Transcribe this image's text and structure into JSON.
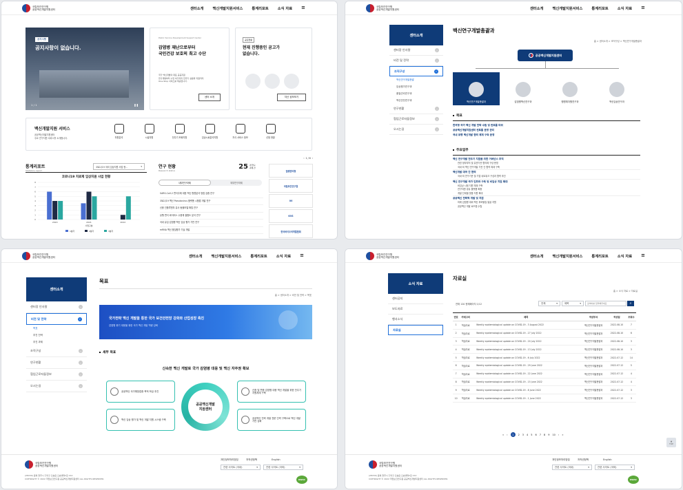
{
  "header": {
    "logo_line1": "국립보건연구원",
    "logo_line2": "공공백신개발지원센터",
    "nav": [
      "센터소개",
      "백신개발지원서비스",
      "통계리포트",
      "소식 자료"
    ],
    "menu_icon": "hamburger-icon"
  },
  "p1": {
    "notice_badge": "공지사항",
    "notice_title": "공지사항이 없습니다.",
    "notice_pager": "1 / 1",
    "promo_small": "Public Vaccine Development Support Center",
    "promo_title1": "감염병 재난으로부터",
    "promo_title2": "국민건강 보호의 최고 수단",
    "promo_desc1": "국가 백신개발의 대표 공공지원",
    "promo_desc2": "연구개발부터 수입 허가까지 전주기 실용화 지원까지",
    "promo_desc3": "One-Stop 서비스를 제공합니다.",
    "promo_btn": "센터 소개",
    "recruit_badge": "공모현황",
    "recruit_title1": "현재 진행중인 공고가",
    "recruit_title2": "없습니다.",
    "recruit_btn": "지난 공모보기",
    "service_title": "백신개발지원 서비스",
    "service_desc1": "공공백신개발지원센터",
    "service_desc2": "주요 연구지원 서비스를 소개합니다.",
    "services": [
      "자원분석",
      "시설자원",
      "전주기 조회지원",
      "임상시료분석지원",
      "지식 서비스 정보",
      "신청 현황"
    ],
    "stats_title": "통계리포트",
    "stats_sub": "Statistics report",
    "stats_select": "코로나19 국외 임상지원 사업 현...",
    "chart_title": "코로나19 치료제 임상지원 사업 현황",
    "research_title": "연구 현황",
    "research_sub": "Research status",
    "research_count": "25",
    "research_unit": "개 연구 과제 건",
    "tab_a": "내부연구과제",
    "tab_b": "외부연구과제",
    "research_list": [
      "SARS-CoV-2 변이주에 대한 백신 항원분석 방법 검증 연구",
      "코로나19 백신 Pseudovirus 플랫폼 시험법 개발 연구",
      "신종 인플루엔자 유사 동물모델 확립 연구",
      "유행 변이 바이러스 수용체 결합도 분석 연구",
      "국내 유입 감염병 백신 임상 평가 기반 연구",
      "mRNA 백신 품질평가 기술 개발"
    ],
    "partners": [
      "질병관리청",
      "국립보건연구원",
      "IVI",
      "KVS",
      "한국바이오의약품협회"
    ],
    "partner_pager": "1 / 6"
  },
  "chart_data": {
    "type": "bar",
    "title": "코로나19 치료제 임상지원 사업 현황",
    "categories": [
      "2020",
      "2021",
      "2022"
    ],
    "xlabel": "사업구분",
    "ylim": [
      0,
      8
    ],
    "y_ticks": [
      "0",
      "1",
      "2",
      "3",
      "4",
      "5",
      "6",
      "7",
      "8"
    ],
    "series": [
      {
        "name": "상반기",
        "color": "#4a6fd1",
        "values": [
          6,
          3.5,
          0
        ]
      },
      {
        "name": "하반기",
        "color": "#1f2a44",
        "values": [
          4,
          6,
          1
        ]
      },
      {
        "name": "합계",
        "color": "#2aa7a0",
        "values": [
          4,
          5,
          5
        ]
      }
    ],
    "legend": [
      "1분기",
      "2분기",
      "3분기"
    ]
  },
  "p2": {
    "side_title": "센터소개",
    "side_items": [
      "센터장 인사말",
      "비전 및 전략",
      "조직구성",
      "연구현황",
      "협업근로자들정보",
      "오시는길"
    ],
    "active_index": 2,
    "sub_items": [
      "백신연구개발총괄",
      "임상평가연구과",
      "품질관리연구과",
      "백신안전연구과"
    ],
    "page_title": "백신연구개발총괄과",
    "breadcrumb": "홈 > 센터소개 > 조직구성 > 백신연구개발총괄과",
    "org_title": "공공백신개발지원센터",
    "org_people": [
      "백신연구개발총괄과",
      "감염병백신연구과",
      "병원체자원연구과",
      "백신임상연구과"
    ],
    "goal_title": "목표",
    "goals": [
      "한국형 국가 백신 개발 전략 수립 및 컨트롤 타워",
      "공공백신개발지원센터 컨트롤 운영 관리",
      "국내 유행 백신개발 협력 체계 구축 운영"
    ],
    "duty_title": "주요업무",
    "duties": [
      {
        "t": "백신 연구개발 전주기 지원을 위한 거버넌스 조직",
        "d": [
          "관련 정부부처 및 유관기관 협의체 구성·운영",
          "국내·외 백신 연구개발 기관 간 협력 체계 구축"
        ]
      },
      {
        "t": "백신개발 대국 간 협력",
        "d": [
          "국내·외 연구기관 및 기업 네트워크 구성과 협력 추진"
        ]
      },
      {
        "t": "백신 연구개발 국가 인프라 구축 및 비임상 지원 확대",
        "d": [
          "비임상 시험 지원 체계 구축",
          "연구자원 공유 플랫폼 확충",
          "개발 단계별 맞춤 지원 확대"
        ]
      },
      {
        "t": "공공백신 전략적 개발 및 지원",
        "d": [
          "미래 감염병 대비 백신 후보물질 발굴 지원",
          "공공백신 개발 로드맵 수립"
        ]
      }
    ]
  },
  "p3": {
    "side_title": "센터소개",
    "side_items": [
      "센터장 인사말",
      "비전 및 전략",
      "조직구성",
      "연구현황",
      "협업근로자들정보",
      "오시는길"
    ],
    "sub_items": [
      "목표",
      "추진 전략",
      "추진 과제"
    ],
    "page_title": "목표",
    "breadcrumb": "홈 > 센터소개 > 비전 및 전략 > 목표",
    "banner_title": "국가전략 백신 개발을 통한 국가 보건안전망 강화와 산업성장 촉진",
    "banner_sub": "감염병 위기 대응을 위한 국가 백신 개발 역량 강화",
    "section_title": "세부 목표",
    "diagram_title": "신속한 백신 개발로 국가 감염병 대응 및 백신 자주권 확보",
    "center_label1": "공공백신개발",
    "center_label2": "지원센터",
    "boxes": [
      "공공백신 국가예방접종 목적 보급 추진",
      "백신 임상 평가 및 백신 개발 지원 시스템 구축",
      "신종 및 변종 감염병 대응 백신 개발을 위한 전주기 지원체계 구축",
      "공공백신 전략 개발 전문 인력 구축으로 백신 개발 기반 강화"
    ]
  },
  "p4": {
    "side_title": "소식 자료",
    "side_items": [
      "센터공지",
      "보도자료",
      "행사소식",
      "자료실"
    ],
    "active_index": 3,
    "page_title": "자료실",
    "breadcrumb": "홈 > 소식 자료 > 자료실",
    "total": "전체 120  현재페이지 1/12",
    "sel1": "전체",
    "sel2": "제목",
    "search_placeholder": "검색어를 입력해주세요",
    "columns": [
      "번호",
      "카테고리",
      "제목",
      "작성부서",
      "작성일",
      "조회수"
    ],
    "rows": [
      [
        "1",
        "학술자료",
        "Weekly epidemiological update on COVID-19 - 3 August 2022",
        "백신연구개발총괄과",
        "2022-08-10",
        "7"
      ],
      [
        "2",
        "학술자료",
        "Weekly epidemiological update on COVID-19 - 27 July 2022",
        "백신연구개발총괄과",
        "2022-08-10",
        "6"
      ],
      [
        "3",
        "학술자료",
        "Weekly epidemiological update on COVID-19 - 20 July 2022",
        "백신연구개발총괄과",
        "2022-08-10",
        "3"
      ],
      [
        "4",
        "학술자료",
        "Weekly epidemiological update on COVID-19 - 13 July 2022",
        "백신연구개발총괄과",
        "2022-08-10",
        "3"
      ],
      [
        "5",
        "학술자료",
        "Weekly epidemiological update on COVID-19 - 6 July 2022",
        "백신연구개발총괄과",
        "2022-07-12",
        "14"
      ],
      [
        "6",
        "학술자료",
        "Weekly epidemiological update on COVID-19 - 29 June 2022",
        "백신연구개발총괄과",
        "2022-07-12",
        "5"
      ],
      [
        "7",
        "학술자료",
        "Weekly epidemiological update on COVID-19 - 22 June 2022",
        "백신연구개발총괄과",
        "2022-07-12",
        "4"
      ],
      [
        "8",
        "학술자료",
        "Weekly epidemiological update on COVID-19 - 15 June 2022",
        "백신연구개발총괄과",
        "2022-07-12",
        "4"
      ],
      [
        "9",
        "학술자료",
        "Weekly epidemiological update on COVID-19 - 8 June 2022",
        "백신연구개발총괄과",
        "2022-07-12",
        "3"
      ],
      [
        "10",
        "학술자료",
        "Weekly epidemiological update on COVID-19 - 1 June 2022",
        "백신연구개발총괄과",
        "2022-07-12",
        "3"
      ]
    ],
    "pages": [
      "1",
      "2",
      "3",
      "4",
      "5",
      "6",
      "7",
      "8",
      "9",
      "10"
    ],
    "top_btn": "TOP"
  },
  "footer": {
    "links": [
      "개인정보처리방침",
      "저작권정책",
      "English"
    ],
    "sel1": "관련 사이트 (국내)",
    "sel2": "관련 사이트 (국외)",
    "addr": "(28159) 충북 청주시 흥덕구 오송읍 오송생명2로 212",
    "copy": "COPYRIGHT © 2022 국립보건연구원 공공백신개발지원센터 ALL RIGHTS RESERVED.",
    "seal": "KWAC"
  }
}
